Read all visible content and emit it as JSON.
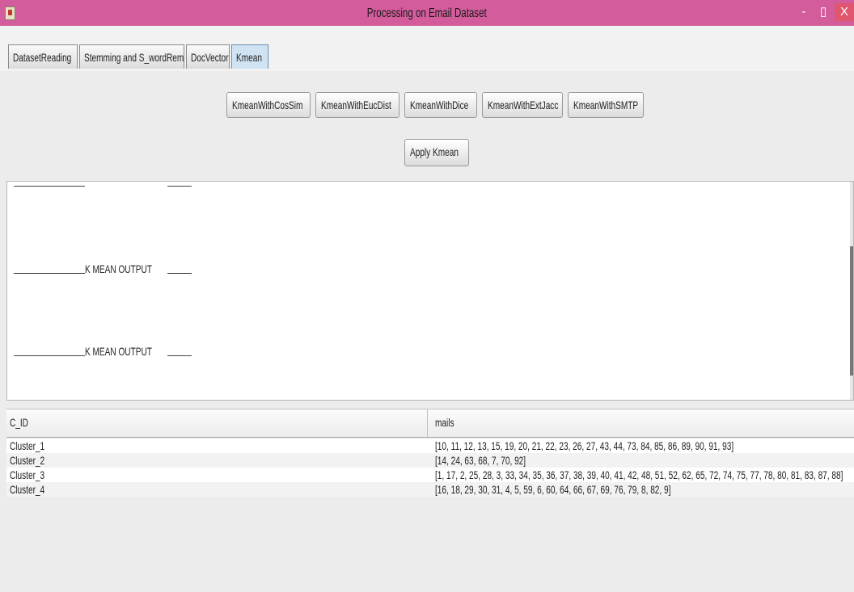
{
  "window": {
    "title": "Processing on Email Dataset",
    "controls": {
      "minimize": "-",
      "restore": "▯",
      "close": "X"
    },
    "titlebar_color": "#d35d9c"
  },
  "tabs": [
    {
      "label": "DatasetReading",
      "active": false
    },
    {
      "label": "Stemming and S_wordRem",
      "active": false
    },
    {
      "label": "DocVector",
      "active": false
    },
    {
      "label": "Kmean",
      "active": true
    }
  ],
  "toolbar": {
    "buttons": [
      "KmeanWithCosSim",
      "KmeanWithEucDist",
      "KmeanWithDice",
      "KmeanWithExtJacc",
      "KmeanWithSMTP"
    ],
    "apply_label": "Apply Kmean"
  },
  "output": {
    "lines": [
      "K MEAN OUTPUT",
      "K MEAN OUTPUT"
    ]
  },
  "table": {
    "columns": [
      "C_ID",
      "mails"
    ],
    "rows": [
      [
        "Cluster_1",
        "[10, 11, 12, 13, 15, 19, 20, 21, 22, 23, 26, 27, 43, 44, 73, 84, 85, 86, 89, 90, 91, 93]"
      ],
      [
        "Cluster_2",
        "[14, 24, 63, 68, 7, 70, 92]"
      ],
      [
        "Cluster_3",
        "[1, 17, 2, 25, 28, 3, 33, 34, 35, 36, 37, 38, 39, 40, 41, 42, 48, 51, 52, 62, 65, 72, 74, 75, 77, 78, 80, 81, 83, 87, 88]"
      ],
      [
        "Cluster_4",
        "[16, 18, 29, 30, 31, 4, 5, 59, 6, 60, 64, 66, 67, 69, 76, 79, 8, 82, 9]"
      ]
    ]
  }
}
